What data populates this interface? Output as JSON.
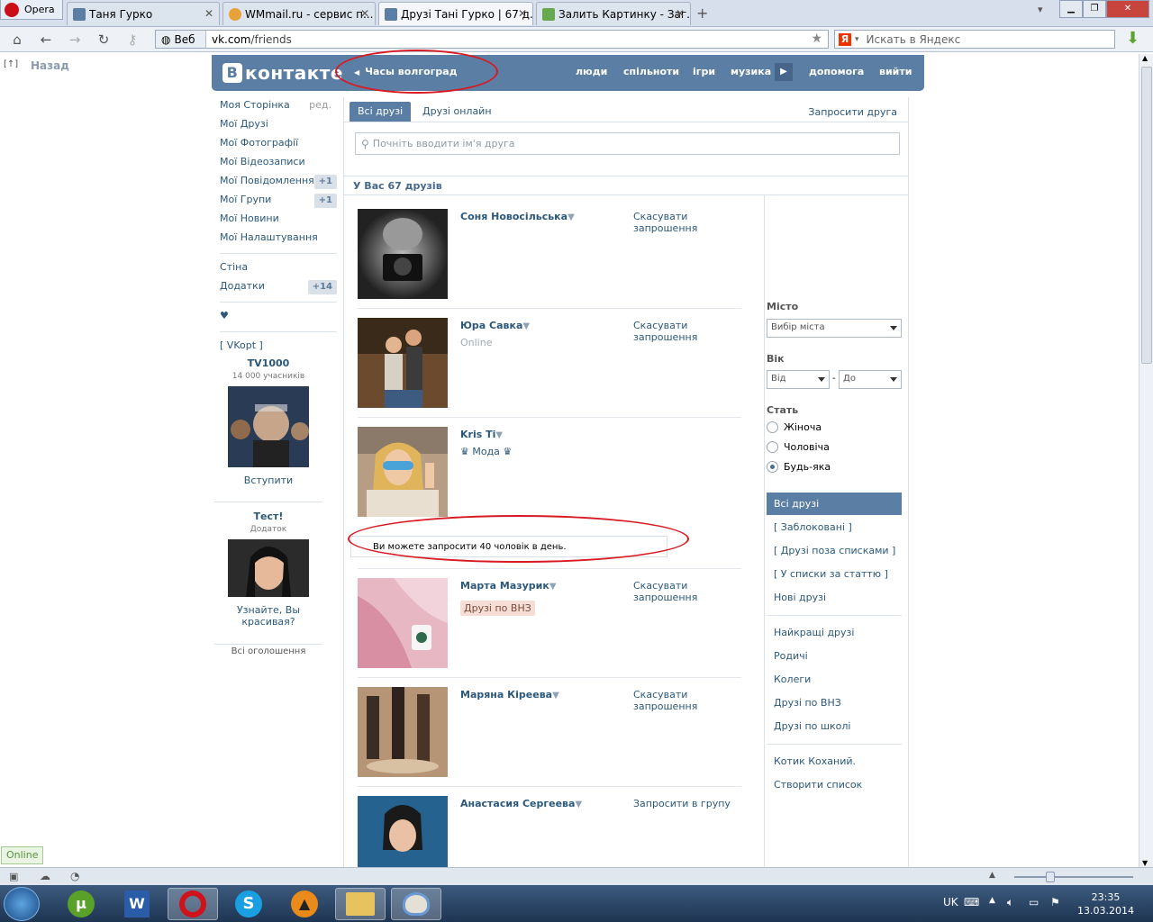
{
  "browser": {
    "opera_label": "Opera",
    "tabs": [
      {
        "title": "Таня Гурко"
      },
      {
        "title": "WMmail.ru - сервис п..."
      },
      {
        "title": "Друзі Тані Гурко | 67 д..."
      },
      {
        "title": "Залить Картинку - Заг..."
      }
    ],
    "web_label": "Веб",
    "url_host": "vk.com",
    "url_path": "/friends",
    "search_placeholder": "Искать в Яндекс",
    "back_label": "Назад"
  },
  "vk_header": {
    "logo": "контакте",
    "logo_letter": "B",
    "status": "Часы волгоград",
    "nav": [
      "люди",
      "спільноти",
      "ігри",
      "музика",
      "допомога",
      "вийти"
    ]
  },
  "left_menu": {
    "items": [
      {
        "label": "Моя Сторінка",
        "extra": "ред."
      },
      {
        "label": "Мої Друзі"
      },
      {
        "label": "Мої Фотографії"
      },
      {
        "label": "Мої Відеозаписи"
      },
      {
        "label": "Мої Повідомлення",
        "count": "+1"
      },
      {
        "label": "Мої Групи",
        "count": "+1"
      },
      {
        "label": "Мої Новини"
      },
      {
        "label": "Мої Налаштування"
      }
    ],
    "apps": [
      {
        "label": "Стіна"
      },
      {
        "label": "Додатки",
        "count": "+14"
      }
    ],
    "heart": "♥",
    "vkopt": "[ VKopt ]"
  },
  "ads": [
    {
      "title": "TV1000",
      "sub": "14 000 учасників",
      "link": "Вступити"
    },
    {
      "title": "Тест!",
      "sub": "Додаток",
      "link": "Узнайте, Вы красивая?"
    }
  ],
  "all_ads_label": "Всі оголошення",
  "friends": {
    "tab_all": "Всі друзі",
    "tab_online": "Друзі онлайн",
    "invite_label": "Запросити друга",
    "search_placeholder": "Почніть вводити ім'я друга",
    "count_label": "У Вас 67 друзів",
    "list": [
      {
        "name": "Соня Новосільська",
        "sub": "",
        "action": "Скасувати запрошення"
      },
      {
        "name": "Юра Савка",
        "sub": "Online",
        "action": "Скасувати запрошення"
      },
      {
        "name": "Kris Ti",
        "sub": "♛ Мода ♛",
        "action": ""
      },
      {
        "name": "Марта Мазурик",
        "sub": "Друзі по ВНЗ",
        "action": "Скасувати запрошення"
      },
      {
        "name": "Маряна Кіреева",
        "sub": "",
        "action": "Скасувати запрошення"
      },
      {
        "name": "Анастасия Сергеева",
        "sub": "",
        "action": "Запросити в групу"
      }
    ],
    "notice": "Ви можете запросити 40 чоловік в день."
  },
  "filters": {
    "city_label": "Місто",
    "city_value": "Вибір міста",
    "age_label": "Вік",
    "age_from": "Від",
    "age_dash": "-",
    "age_to": "До",
    "gender_label": "Стать",
    "gender_options": [
      "Жіноча",
      "Чоловіча",
      "Будь-яка"
    ],
    "gender_selected": "Будь-яка",
    "lists": [
      "Всі друзі",
      "[ Заблоковані ]",
      "[ Друзі поза списками ]",
      "[ У списки за статтю ]",
      "Нові друзі"
    ],
    "groups": [
      "Найкращі друзі",
      "Родичі",
      "Колеги",
      "Друзі по ВНЗ",
      "Друзі по школі"
    ],
    "custom": [
      "Котик Коханий.",
      "Створити список"
    ]
  },
  "status_online": "Online",
  "taskbar": {
    "lang": "UK",
    "time": "23:35",
    "date": "13.03.2014"
  },
  "colors": {
    "vk_blue": "#5b7ea4",
    "link": "#2b587a",
    "annotation_red": "#d81b22"
  }
}
